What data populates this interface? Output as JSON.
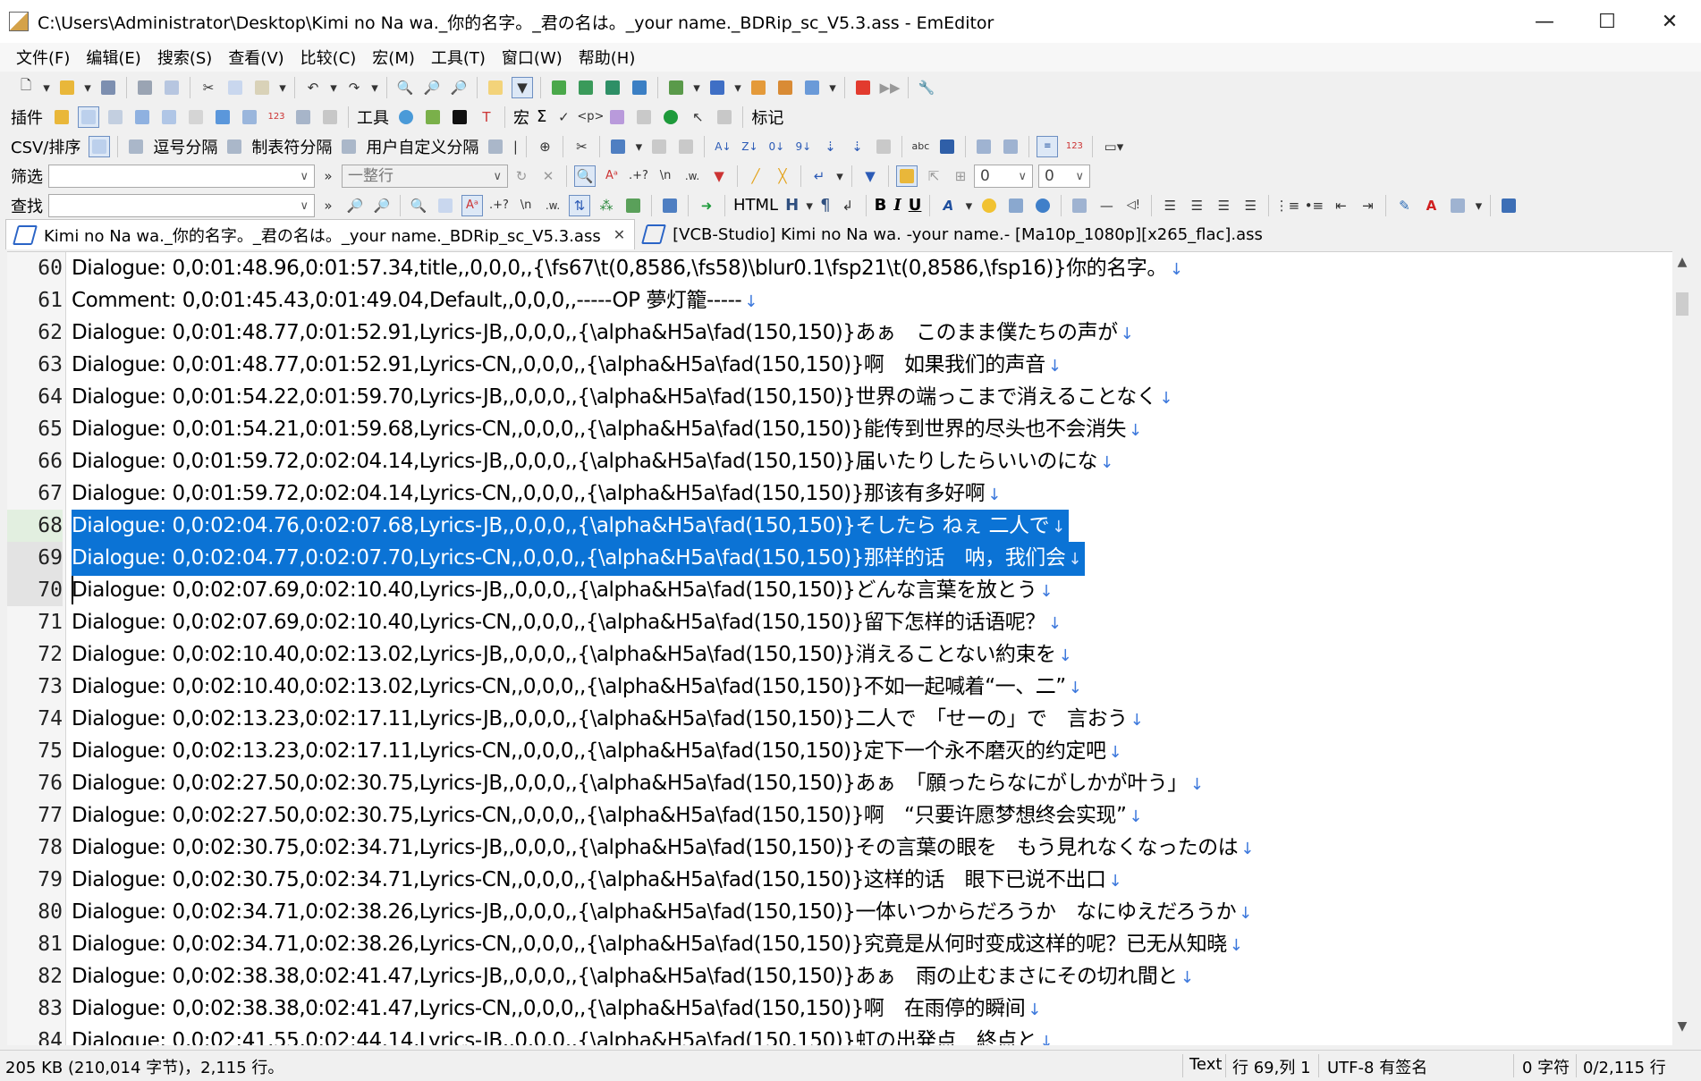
{
  "window": {
    "title": "C:\\Users\\Administrator\\Desktop\\Kimi no Na wa._你的名字。_君の名は。_your name._BDRip_sc_V5.3.ass - EmEditor",
    "minimize": "—",
    "maximize": "☐",
    "close": "✕"
  },
  "menu": [
    "文件(F)",
    "编辑(E)",
    "搜索(S)",
    "查看(V)",
    "比较(C)",
    "宏(M)",
    "工具(T)",
    "窗口(W)",
    "帮助(H)"
  ],
  "toolbars": {
    "plugins_label": "插件",
    "tools_label": "工具",
    "macro_label": "宏",
    "sigma": "Σ",
    "marker_label": "标记",
    "csv_label": "CSV/排序",
    "csv_comma": "逗号分隔",
    "csv_tab": "制表符分隔",
    "csv_user": "用户自定义分隔",
    "filter_label": "筛选",
    "filter_value": "",
    "filter_mode": "一整行",
    "filter_num1": "0",
    "filter_num2": "0",
    "find_label": "查找",
    "find_value": "",
    "html_label": "HTML",
    "bold": "B",
    "italic": "I",
    "underline": "U",
    "heading": "H",
    "pilcrow": "¶"
  },
  "tabs": [
    {
      "label": "Kimi no Na wa._你的名字。_君の名は。_your name._BDRip_sc_V5.3.ass",
      "active": true,
      "close": "✕"
    },
    {
      "label": "[VCB-Studio] Kimi no Na wa. -your name.- [Ma10p_1080p][x265_flac].ass",
      "active": false
    }
  ],
  "editor": {
    "eol_mark": "↓",
    "lines": [
      {
        "num": "60",
        "text": "Dialogue: 0,0:01:48.96,0:01:57.34,title,,0,0,0,,{\\fs67\\t(0,8586,\\fs58)\\blur0.1\\fsp21\\t(0,8586,\\fsp16)}你的名字。"
      },
      {
        "num": "61",
        "text": "Comment: 0,0:01:45.43,0:01:49.04,Default,,0,0,0,,-----OP 夢灯籠-----"
      },
      {
        "num": "62",
        "text": "Dialogue: 0,0:01:48.77,0:01:52.91,Lyrics-JB,,0,0,0,,{\\alpha&H5a\\fad(150,150)}あぁ　このまま僕たちの声が"
      },
      {
        "num": "63",
        "text": "Dialogue: 0,0:01:48.77,0:01:52.91,Lyrics-CN,,0,0,0,,{\\alpha&H5a\\fad(150,150)}啊　如果我们的声音"
      },
      {
        "num": "64",
        "text": "Dialogue: 0,0:01:54.22,0:01:59.70,Lyrics-JB,,0,0,0,,{\\alpha&H5a\\fad(150,150)}世界の端っこまで消えることなく"
      },
      {
        "num": "65",
        "text": "Dialogue: 0,0:01:54.21,0:01:59.68,Lyrics-CN,,0,0,0,,{\\alpha&H5a\\fad(150,150)}能传到世界的尽头也不会消失"
      },
      {
        "num": "66",
        "text": "Dialogue: 0,0:01:59.72,0:02:04.14,Lyrics-JB,,0,0,0,,{\\alpha&H5a\\fad(150,150)}届いたりしたらいいのにな"
      },
      {
        "num": "67",
        "text": "Dialogue: 0,0:01:59.72,0:02:04.14,Lyrics-CN,,0,0,0,,{\\alpha&H5a\\fad(150,150)}那该有多好啊"
      },
      {
        "num": "68",
        "text": "Dialogue: 0,0:02:04.76,0:02:07.68,Lyrics-JB,,0,0,0,,{\\alpha&H5a\\fad(150,150)}そしたら ねぇ 二人で"
      },
      {
        "num": "69",
        "text": "Dialogue: 0,0:02:04.77,0:02:07.70,Lyrics-CN,,0,0,0,,{\\alpha&H5a\\fad(150,150)}那样的话　呐，我们会"
      },
      {
        "num": "70",
        "text": "Dialogue: 0,0:02:07.69,0:02:10.40,Lyrics-JB,,0,0,0,,{\\alpha&H5a\\fad(150,150)}どんな言葉を放とう"
      },
      {
        "num": "71",
        "text": "Dialogue: 0,0:02:07.69,0:02:10.40,Lyrics-CN,,0,0,0,,{\\alpha&H5a\\fad(150,150)}留下怎样的话语呢？"
      },
      {
        "num": "72",
        "text": "Dialogue: 0,0:02:10.40,0:02:13.02,Lyrics-JB,,0,0,0,,{\\alpha&H5a\\fad(150,150)}消えることない約束を"
      },
      {
        "num": "73",
        "text": "Dialogue: 0,0:02:10.40,0:02:13.02,Lyrics-CN,,0,0,0,,{\\alpha&H5a\\fad(150,150)}不如一起喊着“一、二”"
      },
      {
        "num": "74",
        "text": "Dialogue: 0,0:02:13.23,0:02:17.11,Lyrics-JB,,0,0,0,,{\\alpha&H5a\\fad(150,150)}二人で　「せーの」で　言おう"
      },
      {
        "num": "75",
        "text": "Dialogue: 0,0:02:13.23,0:02:17.11,Lyrics-CN,,0,0,0,,{\\alpha&H5a\\fad(150,150)}定下一个永不磨灭的约定吧"
      },
      {
        "num": "76",
        "text": "Dialogue: 0,0:02:27.50,0:02:30.75,Lyrics-JB,,0,0,0,,{\\alpha&H5a\\fad(150,150)}あぁ　「願ったらなにがしかが叶う」"
      },
      {
        "num": "77",
        "text": "Dialogue: 0,0:02:27.50,0:02:30.75,Lyrics-CN,,0,0,0,,{\\alpha&H5a\\fad(150,150)}啊　“只要许愿梦想终会实现”"
      },
      {
        "num": "78",
        "text": "Dialogue: 0,0:02:30.75,0:02:34.71,Lyrics-JB,,0,0,0,,{\\alpha&H5a\\fad(150,150)}その言葉の眼を　もう見れなくなったのは"
      },
      {
        "num": "79",
        "text": "Dialogue: 0,0:02:30.75,0:02:34.71,Lyrics-CN,,0,0,0,,{\\alpha&H5a\\fad(150,150)}这样的话　眼下已说不出口"
      },
      {
        "num": "80",
        "text": "Dialogue: 0,0:02:34.71,0:02:38.26,Lyrics-JB,,0,0,0,,{\\alpha&H5a\\fad(150,150)}一体いつからだろうか　なにゆえだろうか"
      },
      {
        "num": "81",
        "text": "Dialogue: 0,0:02:34.71,0:02:38.26,Lyrics-CN,,0,0,0,,{\\alpha&H5a\\fad(150,150)}究竟是从何时变成这样的呢？已无从知晓"
      },
      {
        "num": "82",
        "text": "Dialogue: 0,0:02:38.38,0:02:41.47,Lyrics-JB,,0,0,0,,{\\alpha&H5a\\fad(150,150)}あぁ　雨の止むまさにその切れ間と"
      },
      {
        "num": "83",
        "text": "Dialogue: 0,0:02:38.38,0:02:41.47,Lyrics-CN,,0,0,0,,{\\alpha&H5a\\fad(150,150)}啊　在雨停的瞬间"
      },
      {
        "num": "84",
        "text": "Dialogue: 0,0:02:41.55,0:02:44.14,Lyrics-JB,,0,0,0,,{\\alpha&H5a\\fad(150,150)}虹の出発点　終点と"
      }
    ],
    "selected_lines": [
      "68",
      "69"
    ],
    "current_line": "70"
  },
  "status": {
    "size": "205 KB (210,014 字节)，2,115 行。",
    "mode": "Text",
    "position": "行 69,列 1",
    "encoding": "UTF-8 有签名",
    "chars": "0 字符",
    "lines_sel": "0/2,115 行"
  },
  "colors": {
    "selection": "#0b73d5",
    "eol_mark": "#3c78dc",
    "gutter": "#f5f5f5"
  }
}
